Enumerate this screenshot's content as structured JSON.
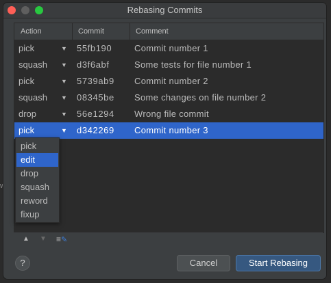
{
  "window": {
    "title": "Rebasing Commits"
  },
  "table": {
    "headers": {
      "action": "Action",
      "commit": "Commit",
      "comment": "Comment"
    },
    "rows": [
      {
        "action": "pick",
        "hash": "55fb190",
        "comment": "Commit number 1"
      },
      {
        "action": "squash",
        "hash": "d3f6abf",
        "comment": "Some tests for file number 1"
      },
      {
        "action": "pick",
        "hash": "5739ab9",
        "comment": "Commit number 2"
      },
      {
        "action": "squash",
        "hash": "08345be",
        "comment": "Some changes on file number 2"
      },
      {
        "action": "drop",
        "hash": "56e1294",
        "comment": "Wrong file commit"
      },
      {
        "action": "pick",
        "hash": "d342269",
        "comment": "Commit number 3"
      }
    ],
    "selected_row": 5
  },
  "action_dropdown": {
    "options": [
      "pick",
      "edit",
      "drop",
      "squash",
      "reword",
      "fixup"
    ],
    "highlighted": "edit"
  },
  "toolbar": {
    "move_up_icon": "arrow-up-icon",
    "move_down_icon": "arrow-down-icon",
    "edit_message_icon": "edit-message-icon"
  },
  "buttons": {
    "help": "?",
    "cancel": "Cancel",
    "start": "Start Rebasing"
  },
  "background": {
    "edge_char": "w"
  },
  "colors": {
    "selection": "#2f65ca",
    "panel": "#3c3f41",
    "table_bg": "#2b2b2b",
    "primary_button": "#365880"
  }
}
